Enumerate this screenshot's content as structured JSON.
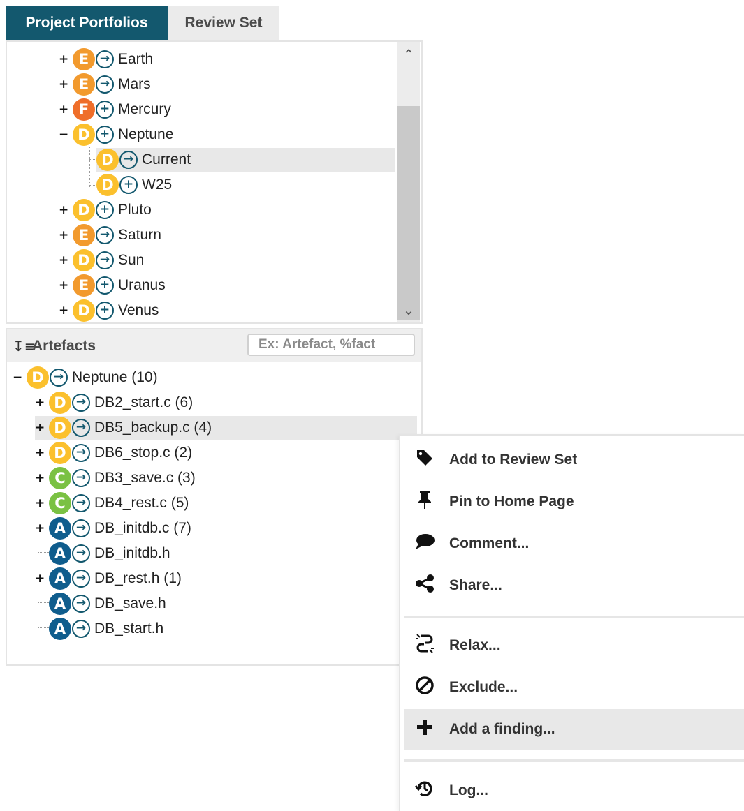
{
  "tabs": [
    {
      "label": "Project Portfolios",
      "active": true
    },
    {
      "label": "Review Set",
      "active": false
    }
  ],
  "portfolio": {
    "items": [
      {
        "label": "Earth",
        "grade": "E",
        "expander": "+",
        "trend": "→"
      },
      {
        "label": "Mars",
        "grade": "E",
        "expander": "+",
        "trend": "→"
      },
      {
        "label": "Mercury",
        "grade": "F",
        "expander": "+",
        "trend": "+"
      },
      {
        "label": "Neptune",
        "grade": "D",
        "expander": "−",
        "trend": "+"
      },
      {
        "label": "Current",
        "grade": "D",
        "expander": "",
        "trend": "→",
        "selected": true
      },
      {
        "label": "W25",
        "grade": "D",
        "expander": "",
        "trend": "+"
      },
      {
        "label": "Pluto",
        "grade": "D",
        "expander": "+",
        "trend": "+"
      },
      {
        "label": "Saturn",
        "grade": "E",
        "expander": "+",
        "trend": "→"
      },
      {
        "label": "Sun",
        "grade": "D",
        "expander": "+",
        "trend": "→"
      },
      {
        "label": "Uranus",
        "grade": "E",
        "expander": "+",
        "trend": "+"
      },
      {
        "label": "Venus",
        "grade": "D",
        "expander": "+",
        "trend": "+"
      }
    ]
  },
  "artefacts": {
    "title": "Artefacts",
    "search_placeholder": "Ex: Artefact, %fact",
    "root": {
      "label": "Neptune (10)",
      "grade": "D",
      "expander": "−",
      "trend": "→"
    },
    "items": [
      {
        "label": "DB2_start.c (6)",
        "grade": "D",
        "expander": "+",
        "trend": "→"
      },
      {
        "label": "DB5_backup.c (4)",
        "grade": "D",
        "expander": "+",
        "trend": "→",
        "selected": true
      },
      {
        "label": "DB6_stop.c (2)",
        "grade": "D",
        "expander": "+",
        "trend": "→"
      },
      {
        "label": "DB3_save.c (3)",
        "grade": "C",
        "expander": "+",
        "trend": "→"
      },
      {
        "label": "DB4_rest.c (5)",
        "grade": "C",
        "expander": "+",
        "trend": "→"
      },
      {
        "label": "DB_initdb.c (7)",
        "grade": "A",
        "expander": "+",
        "trend": "→"
      },
      {
        "label": "DB_initdb.h",
        "grade": "A",
        "expander": "",
        "trend": "→"
      },
      {
        "label": "DB_rest.h (1)",
        "grade": "A",
        "expander": "+",
        "trend": "→"
      },
      {
        "label": "DB_save.h",
        "grade": "A",
        "expander": "",
        "trend": "→"
      },
      {
        "label": "DB_start.h",
        "grade": "A",
        "expander": "",
        "trend": "→"
      }
    ]
  },
  "context_menu": {
    "items": [
      {
        "label": "Add to Review Set",
        "icon": "tag-icon"
      },
      {
        "label": "Pin to Home Page",
        "icon": "pin-icon"
      },
      {
        "label": "Comment...",
        "icon": "comment-icon"
      },
      {
        "label": "Share...",
        "icon": "share-icon"
      },
      {
        "label": "Relax...",
        "icon": "relax-icon"
      },
      {
        "label": "Exclude...",
        "icon": "exclude-icon"
      },
      {
        "label": "Add a finding...",
        "icon": "plus-icon",
        "highlighted": true
      },
      {
        "label": "Log...",
        "icon": "history-icon"
      }
    ]
  },
  "colors": {
    "tab_active": "#13586e",
    "grade_A": "#0f5d8d",
    "grade_C": "#7ac143",
    "grade_D": "#fbc02d",
    "grade_E": "#f29a2e",
    "grade_F": "#ef6e2a"
  }
}
